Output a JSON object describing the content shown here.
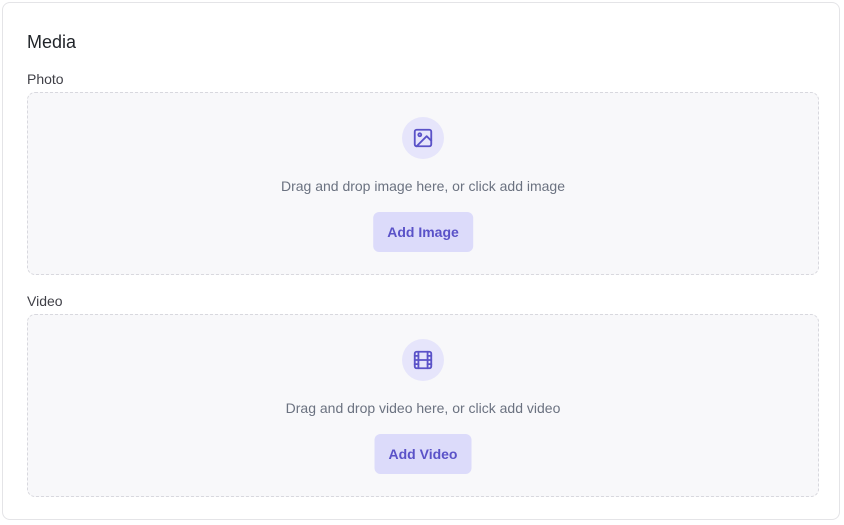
{
  "section": {
    "title": "Media"
  },
  "photo": {
    "label": "Photo",
    "icon": "image-icon",
    "instruction": "Drag and drop image here, or click add image",
    "button_label": "Add Image"
  },
  "video": {
    "label": "Video",
    "icon": "film-icon",
    "instruction": "Drag and drop video here, or click add video",
    "button_label": "Add Video"
  },
  "colors": {
    "accent": "#5a52c8",
    "accent_bg": "#dcdbfa",
    "icon_circle_bg": "#e6e5fb",
    "dropzone_bg": "#f8f8fa"
  }
}
